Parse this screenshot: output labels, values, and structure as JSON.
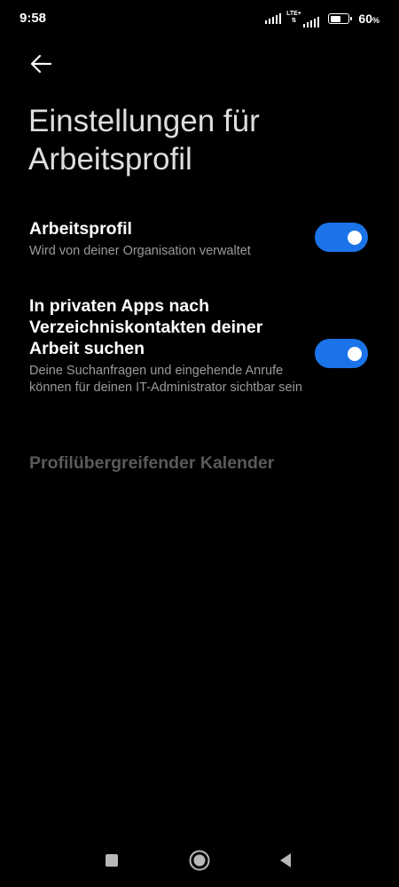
{
  "status_bar": {
    "time": "9:58",
    "network": "LTE+",
    "battery_percent": 60,
    "battery_label": "60",
    "battery_unit": "%"
  },
  "header": {
    "back_icon": "arrow-left-icon",
    "title": "Einstellungen für Arbeitsprofil"
  },
  "settings": [
    {
      "title": "Arbeitsprofil",
      "summary": "Wird von deiner Organisation verwaltet",
      "enabled": true
    },
    {
      "title": "In privaten Apps nach Verzeichniskontakten deiner Arbeit suchen",
      "summary": "Deine Suchanfragen und eingehende Anrufe können für deinen IT-Administrator sichtbar sein",
      "enabled": true
    },
    {
      "title": "Profilübergreifender Kalender",
      "disabled": true
    }
  ],
  "nav_bar": {
    "recents_icon": "square-icon",
    "home_icon": "circle-icon",
    "back_icon": "triangle-back-icon"
  },
  "colors": {
    "background": "#000000",
    "accent": "#1a73e8",
    "summary_text": "#9a9a9a",
    "disabled_text": "#5a5a5a"
  }
}
